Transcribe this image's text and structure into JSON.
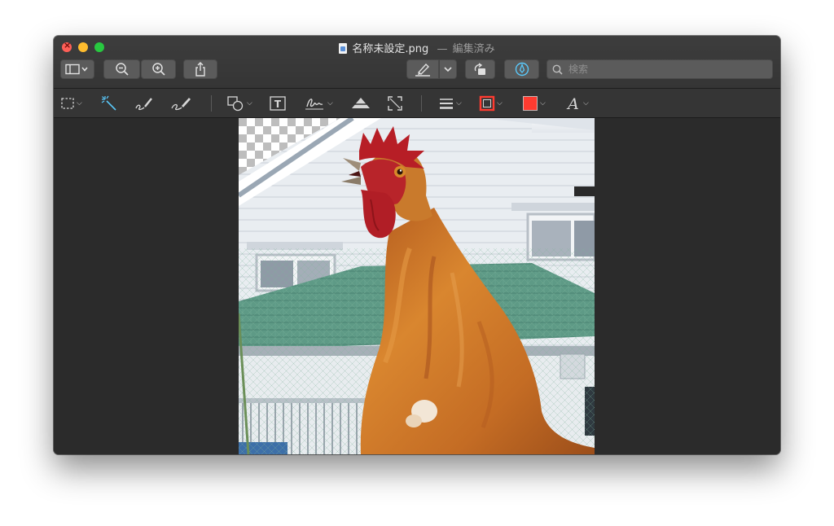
{
  "window": {
    "title": "名称未設定.png",
    "title_separator": "—",
    "edited_label": "編集済み",
    "file_icon": "png-file-icon"
  },
  "toolbar": {
    "sidebar_button_icon": "sidebar-icon",
    "zoom_out_icon": "zoom-out-icon",
    "zoom_in_icon": "zoom-in-icon",
    "share_icon": "share-icon",
    "highlight_icon": "highlighter-icon",
    "rotate_icon": "rotate-icon",
    "markup_icon": "markup-pen-icon",
    "search": {
      "placeholder": "検索",
      "value": ""
    }
  },
  "markup_tools": [
    "rect-selection-icon",
    "instant-alpha-icon",
    "sketch-icon",
    "draw-icon",
    "shapes-icon",
    "text-icon",
    "sign-icon",
    "adjust-color-icon",
    "adjust-size-icon",
    "line-style-icon",
    "border-color-icon",
    "fill-color-icon",
    "text-style-icon"
  ],
  "colors": {
    "border_color": "#ff3b30",
    "fill_color": "#ff3b30",
    "markup_accent": "#5ac8fa"
  },
  "image": {
    "subject": "rooster-photo"
  }
}
